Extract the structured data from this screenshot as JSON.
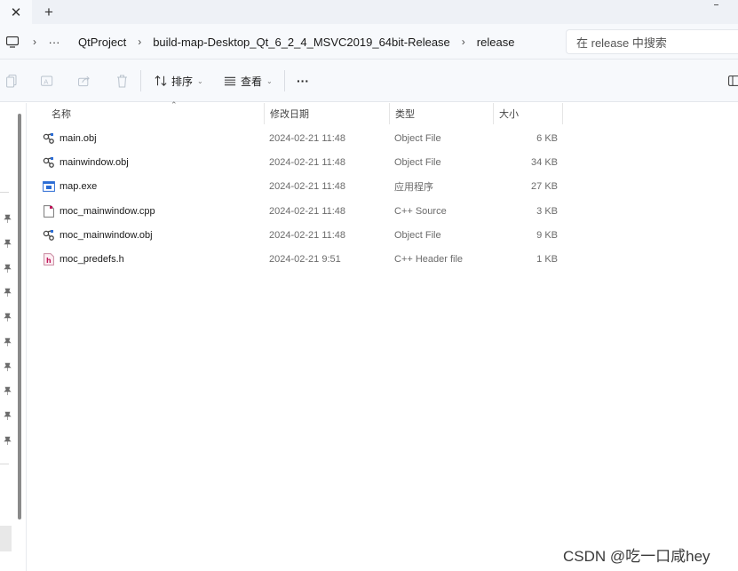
{
  "tabbar": {
    "close_glyph": "✕",
    "new_tab_glyph": "+",
    "window_controls_glyph": "⎯"
  },
  "address": {
    "overflow_glyph": "···",
    "separator_glyph": "›",
    "crumbs": [
      "QtProject",
      "build-map-Desktop_Qt_6_2_4_MSVC2019_64bit-Release",
      "release"
    ]
  },
  "search": {
    "placeholder": "在 release 中搜索"
  },
  "toolbar": {
    "icons": [
      "copy-icon",
      "rename-icon",
      "share-icon",
      "delete-icon"
    ],
    "sort_label": "排序",
    "view_label": "查看",
    "more_glyph": "···"
  },
  "columns": {
    "name": "名称",
    "date": "修改日期",
    "type": "类型",
    "size": "大小"
  },
  "files": [
    {
      "name": "main.obj",
      "date": "2024-02-21 11:48",
      "type": "Object File",
      "size": "6 KB",
      "icon": "obj-file-icon"
    },
    {
      "name": "mainwindow.obj",
      "date": "2024-02-21 11:48",
      "type": "Object File",
      "size": "34 KB",
      "icon": "obj-file-icon"
    },
    {
      "name": "map.exe",
      "date": "2024-02-21 11:48",
      "type": "应用程序",
      "size": "27 KB",
      "icon": "exe-file-icon"
    },
    {
      "name": "moc_mainwindow.cpp",
      "date": "2024-02-21 11:48",
      "type": "C++ Source",
      "size": "3 KB",
      "icon": "cpp-file-icon"
    },
    {
      "name": "moc_mainwindow.obj",
      "date": "2024-02-21 11:48",
      "type": "Object File",
      "size": "9 KB",
      "icon": "obj-file-icon"
    },
    {
      "name": "moc_predefs.h",
      "date": "2024-02-21 9:51",
      "type": "C++ Header file",
      "size": "1 KB",
      "icon": "header-file-icon"
    }
  ],
  "watermark": "CSDN @吃一口咸hey",
  "colors": {
    "accent": "#2b6cd4",
    "chrome_bg": "#f7f9fc",
    "header_red": "#c2185b"
  }
}
